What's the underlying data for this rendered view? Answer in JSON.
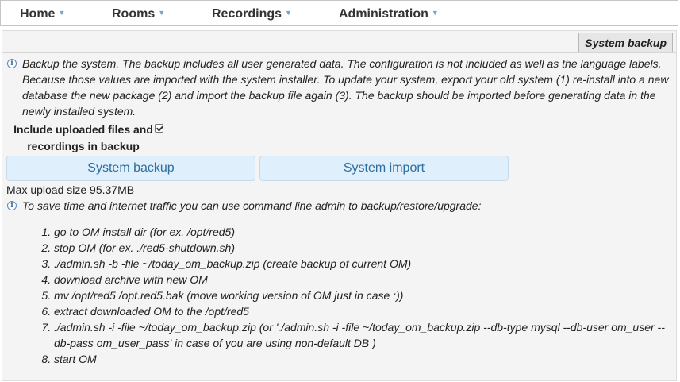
{
  "menu": {
    "items": [
      {
        "label": "Home"
      },
      {
        "label": "Rooms"
      },
      {
        "label": "Recordings"
      },
      {
        "label": "Administration"
      }
    ]
  },
  "panel": {
    "tab_label": "System backup",
    "intro_text": "Backup the system. The backup includes all user generated data. The configuration is not included as well as the language labels. Because those values are imported with the system installer. To update your system, export your old system (1) re-install into a new database the new package (2) and import the backup file again (3). The backup should be imported before generating data in the newly installed system.",
    "include_files_label": "Include uploaded files and recordings in backup",
    "include_files_checked": true,
    "backup_button_label": "System backup",
    "import_button_label": "System import",
    "max_upload_text": "Max upload size 95.37MB",
    "cli_text": "To save time and internet traffic you can use command line admin to backup/restore/upgrade:",
    "steps": [
      "go to OM install dir (for ex. /opt/red5)",
      "stop OM (for ex. ./red5-shutdown.sh)",
      "./admin.sh -b -file ~/today_om_backup.zip (create backup of current OM)",
      "download archive with new OM",
      "mv /opt/red5 /opt.red5.bak (move working version of OM just in case :))",
      "extract downloaded OM to the /opt/red5",
      "./admin.sh -i -file ~/today_om_backup.zip (or './admin.sh -i -file ~/today_om_backup.zip --db-type mysql --db-user om_user --db-pass om_user_pass' in case of you are using non-default DB )",
      "start OM"
    ]
  },
  "colors": {
    "button_bg": "#dfeffc",
    "button_text": "#2e6e9e",
    "panel_bg": "#f4f4f4"
  }
}
